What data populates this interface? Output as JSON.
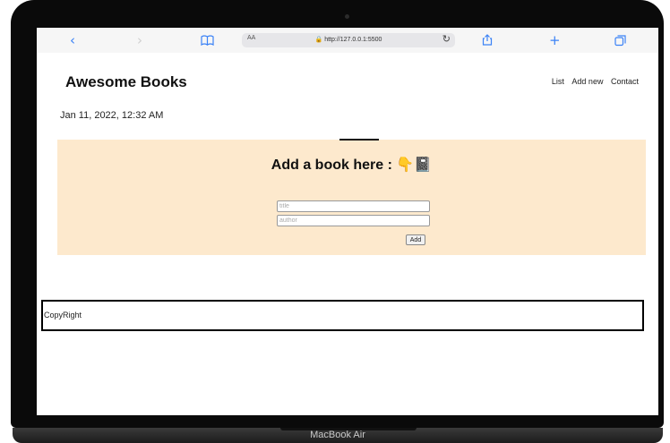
{
  "device": {
    "model_label": "MacBook Air"
  },
  "browser": {
    "back_icon": "chevron-left-icon",
    "forward_icon": "chevron-right-icon",
    "bookmarks_icon": "book-icon",
    "reader_label": "AA",
    "url": "http://127.0.0.1:5500",
    "reload_icon": "reload-icon",
    "share_icon": "share-icon",
    "new_tab_icon": "plus-icon",
    "tabs_icon": "tabs-icon"
  },
  "header": {
    "brand": "Awesome Books",
    "nav": [
      "List",
      "Add new",
      "Contact"
    ]
  },
  "main": {
    "date": "Jan 11, 2022, 12:32 AM",
    "form": {
      "heading": "Add a book here : 👇📓",
      "title_placeholder": "title",
      "author_placeholder": "author",
      "add_label": "Add"
    }
  },
  "footer": {
    "text": "CopyRight"
  },
  "colors": {
    "panel_bg": "#fde9cd",
    "accent_blue": "#3b82f6"
  }
}
